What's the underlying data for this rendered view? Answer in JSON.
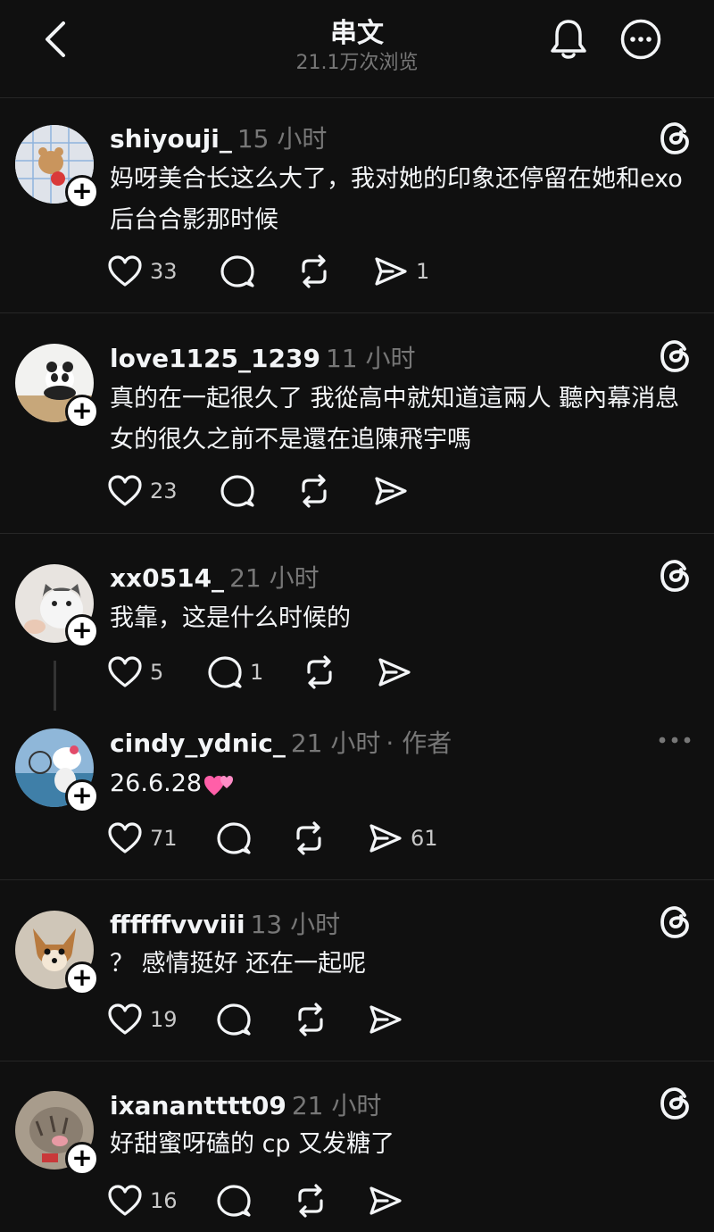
{
  "header": {
    "title": "串文",
    "subtitle": "21.1万次浏览"
  },
  "posts": [
    {
      "username": "shiyouji_",
      "time": "15 小时",
      "text": "妈呀美合长这么大了，我对她的印象还停留在她和exo后台合影那时候",
      "likes": "33",
      "comments": "",
      "shares": "1"
    },
    {
      "username": "love1125_1239",
      "time": "11 小时",
      "text": "真的在一起很久了 我從高中就知道這兩人 聽內幕消息 女的很久之前不是還在追陳飛宇嗎",
      "likes": "23",
      "comments": "",
      "shares": ""
    },
    {
      "username": "xx0514_",
      "time": "21 小时",
      "text": "我靠，这是什么时候的",
      "likes": "5",
      "comments": "1",
      "shares": ""
    },
    {
      "username": "cindy_ydnic_",
      "time": "21 小时",
      "author_tag": "· 作者",
      "text": "26.6.28",
      "likes": "71",
      "comments": "",
      "shares": "61"
    },
    {
      "username": "ffffffvvviii",
      "time": "13 小时",
      "text": "？ 感情挺好 还在一起呢",
      "likes": "19",
      "comments": "",
      "shares": ""
    },
    {
      "username": "ixanantttt09",
      "time": "21 小时",
      "text": "好甜蜜呀磕的 cp 又发糖了",
      "likes": "16",
      "comments": "",
      "shares": ""
    }
  ],
  "icons": {
    "back": "chevron-left-icon",
    "bell": "bell-icon",
    "more": "more-circle-icon",
    "threads": "threads-logo-icon",
    "like": "heart-icon",
    "comment": "comment-icon",
    "repost": "repost-icon",
    "share": "share-icon"
  },
  "colors": {
    "background": "#101010",
    "text": "#f3f5f7",
    "secondary": "#777777",
    "divider": "#262626"
  }
}
